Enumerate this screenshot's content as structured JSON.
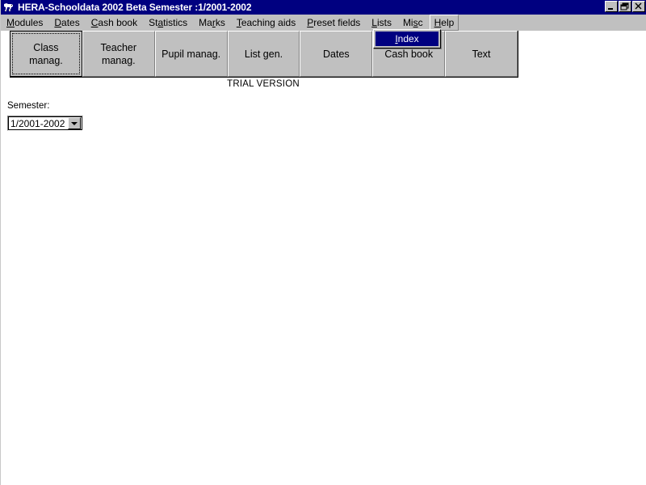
{
  "window": {
    "title": "HERA-Schooldata 2002 Beta Semester :1/2001-2002",
    "icon": "horse-logo-icon",
    "colors": {
      "titlebar": "#000080",
      "face": "#c0c0c0",
      "highlight": "#000080",
      "client": "#ffffff"
    },
    "controls": [
      {
        "name": "minimize-button",
        "glyph": "minimize-icon"
      },
      {
        "name": "restore-button",
        "glyph": "restore-icon"
      },
      {
        "name": "close-button",
        "glyph": "close-icon"
      }
    ]
  },
  "menubar": {
    "items": [
      {
        "label": "Modules",
        "accel": "M",
        "pre": "",
        "post": "odules",
        "open": false
      },
      {
        "label": "Dates",
        "accel": "D",
        "pre": "",
        "post": "ates",
        "open": false
      },
      {
        "label": "Cash book",
        "accel": "C",
        "pre": "",
        "post": "ash book",
        "open": false
      },
      {
        "label": "Statistics",
        "accel": "a",
        "pre": "St",
        "post": "tistics",
        "open": false
      },
      {
        "label": "Marks",
        "accel": "r",
        "pre": "Ma",
        "post": "ks",
        "open": false
      },
      {
        "label": "Teaching aids",
        "accel": "T",
        "pre": "",
        "post": "eaching aids",
        "open": false
      },
      {
        "label": "Preset fields",
        "accel": "P",
        "pre": "",
        "post": "reset fields",
        "open": false
      },
      {
        "label": "Lists",
        "accel": "L",
        "pre": "",
        "post": "ists",
        "open": false
      },
      {
        "label": "Misc",
        "accel": "s",
        "pre": "Mi",
        "post": "c",
        "open": false
      },
      {
        "label": "Help",
        "accel": "H",
        "pre": "",
        "post": "elp",
        "open": true
      }
    ]
  },
  "help_menu": {
    "open": true,
    "items": [
      {
        "label": "Index",
        "accel": "I",
        "pre": "",
        "post": "ndex",
        "selected": true
      }
    ]
  },
  "toolbar": {
    "buttons": [
      {
        "label": "Class manag.",
        "line1": "Class",
        "line2": "manag.",
        "name": "class-manag-button",
        "default": true
      },
      {
        "label": "Teacher manag.",
        "line1": "Teacher",
        "line2": "manag.",
        "name": "teacher-manag-button",
        "default": false
      },
      {
        "label": "Pupil manag.",
        "line1": "Pupil manag.",
        "line2": "",
        "name": "pupil-manag-button",
        "default": false
      },
      {
        "label": "List gen.",
        "line1": "List gen.",
        "line2": "",
        "name": "list-gen-button",
        "default": false
      },
      {
        "label": "Dates",
        "line1": "Dates",
        "line2": "",
        "name": "dates-button",
        "default": false
      },
      {
        "label": "Cash book",
        "line1": "Cash book",
        "line2": "",
        "name": "cash-book-button",
        "default": false
      },
      {
        "label": "Text",
        "line1": "Text",
        "line2": "",
        "name": "text-button",
        "default": false
      }
    ]
  },
  "main": {
    "trial_notice": "TRIAL VERSION",
    "semester": {
      "label": "Semester:",
      "value": "1/2001-2002",
      "arrow": "chevron-down-icon"
    }
  }
}
